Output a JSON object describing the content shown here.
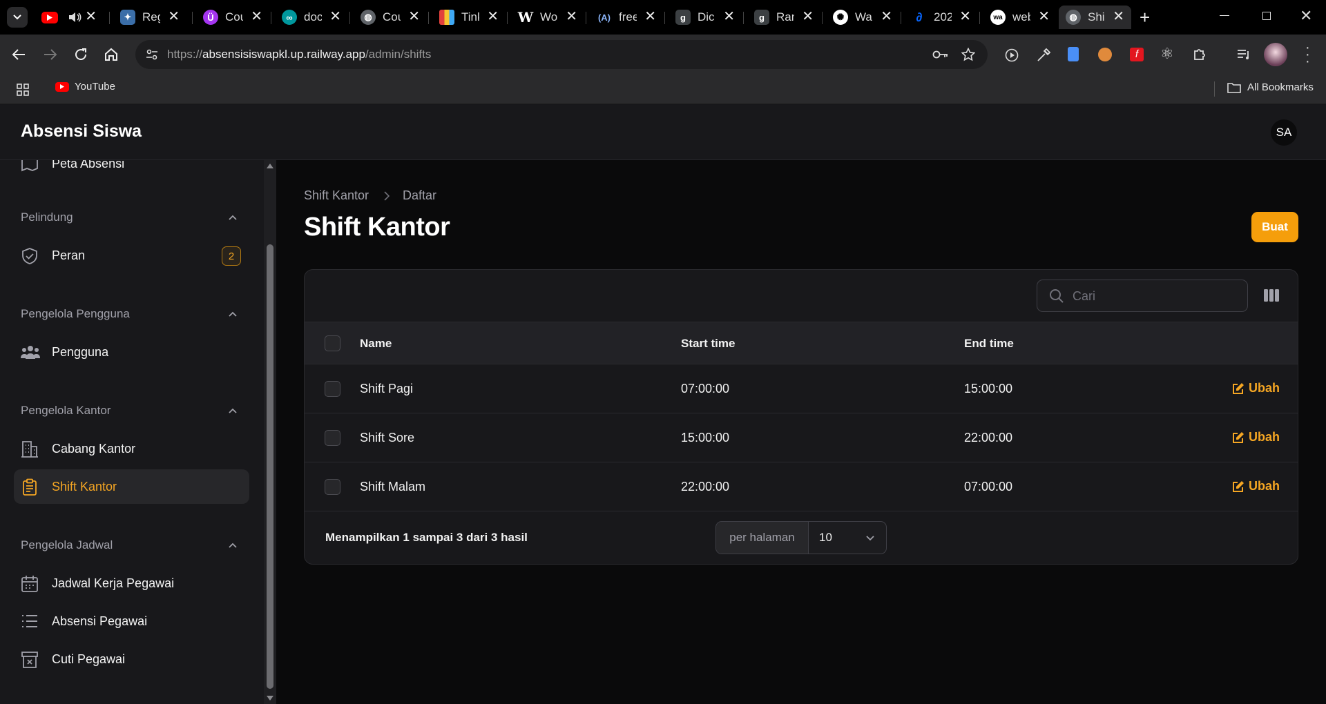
{
  "browser": {
    "tabs": [
      {
        "label": "",
        "icon": "youtube-icon",
        "color": "#ff0000"
      },
      {
        "label": "Reg",
        "icon": "puzzle-icon",
        "color": "#3b6ea8"
      },
      {
        "label": "Cou",
        "icon": "udemy-icon",
        "color": "#a435f0"
      },
      {
        "label": "doc",
        "icon": "arduino-icon",
        "color": "#00979d"
      },
      {
        "label": "Cou",
        "icon": "globe-icon",
        "color": "#9aa0a6"
      },
      {
        "label": "Tink",
        "icon": "tinkercad-icon",
        "color": "#e2403c"
      },
      {
        "label": "Wo",
        "icon": "wokwi-icon",
        "color": "#ffffff"
      },
      {
        "label": "free",
        "icon": "api-icon",
        "color": "#8ab4f8"
      },
      {
        "label": "Dic",
        "icon": "g-icon",
        "color": "#8ab4f8"
      },
      {
        "label": "Ran",
        "icon": "g-icon",
        "color": "#8ab4f8"
      },
      {
        "label": "Wa",
        "icon": "openai-icon",
        "color": "#ffffff"
      },
      {
        "label": "202",
        "icon": "meta-icon",
        "color": "#0866ff"
      },
      {
        "label": "web",
        "icon": "wa-icon",
        "color": "#ffffff"
      },
      {
        "label": "Shi",
        "icon": "globe-icon",
        "color": "#9aa0a6",
        "active": true
      }
    ],
    "url_scheme": "https://",
    "url_host": "absensisiswapkl.up.railway.app",
    "url_path": "/admin/shifts",
    "bookmarks": [
      {
        "label": "YouTube",
        "icon": "youtube-icon"
      }
    ],
    "all_bookmarks": "All Bookmarks"
  },
  "app": {
    "brand": "Absensi Siswa",
    "avatar_initials": "SA",
    "accent": "#f59e0b"
  },
  "sidebar": {
    "partial_item": "Peta Absensi",
    "groups": [
      {
        "label": "Pelindung",
        "items": [
          {
            "label": "Peran",
            "icon": "shield-check-icon",
            "badge": "2"
          }
        ]
      },
      {
        "label": "Pengelola Pengguna",
        "items": [
          {
            "label": "Pengguna",
            "icon": "users-icon"
          }
        ]
      },
      {
        "label": "Pengelola Kantor",
        "items": [
          {
            "label": "Cabang Kantor",
            "icon": "building-icon"
          },
          {
            "label": "Shift Kantor",
            "icon": "clipboard-icon",
            "active": true
          }
        ]
      },
      {
        "label": "Pengelola Jadwal",
        "items": [
          {
            "label": "Jadwal Kerja Pegawai",
            "icon": "calendar-icon"
          },
          {
            "label": "Absensi Pegawai",
            "icon": "list-icon"
          },
          {
            "label": "Cuti Pegawai",
            "icon": "archive-x-icon"
          }
        ]
      }
    ]
  },
  "page": {
    "breadcrumb": [
      "Shift Kantor",
      "Daftar"
    ],
    "title": "Shift Kantor",
    "create_label": "Buat",
    "search_placeholder": "Cari",
    "columns": [
      "Name",
      "Start time",
      "End time"
    ],
    "rows": [
      {
        "name": "Shift Pagi",
        "start": "07:00:00",
        "end": "15:00:00",
        "action": "Ubah"
      },
      {
        "name": "Shift Sore",
        "start": "15:00:00",
        "end": "22:00:00",
        "action": "Ubah"
      },
      {
        "name": "Shift Malam",
        "start": "22:00:00",
        "end": "07:00:00",
        "action": "Ubah"
      }
    ],
    "summary": "Menampilkan 1 sampai 3 dari 3 hasil",
    "per_page_label": "per halaman",
    "per_page_value": "10"
  }
}
